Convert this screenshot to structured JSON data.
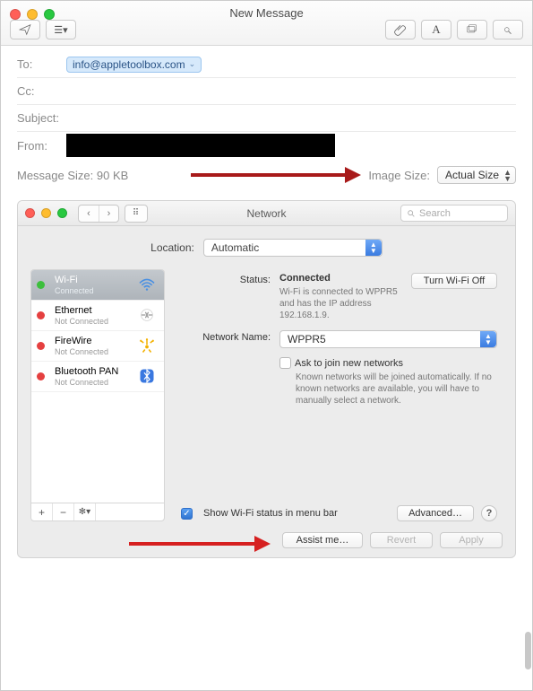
{
  "mail": {
    "title": "New Message",
    "to_label": "To:",
    "to_chip": "info@appletoolbox.com",
    "cc_label": "Cc:",
    "subject_label": "Subject:",
    "from_label": "From:",
    "message_size_label": "Message Size: 90 KB",
    "image_size_label": "Image Size:",
    "image_size_value": "Actual Size"
  },
  "network": {
    "title": "Network",
    "search_placeholder": "Search",
    "location_label": "Location:",
    "location_value": "Automatic",
    "sidebar": {
      "items": [
        {
          "name": "Wi-Fi",
          "sub": "Connected",
          "status": "green",
          "icon": "wifi",
          "selected": true
        },
        {
          "name": "Ethernet",
          "sub": "Not Connected",
          "status": "red",
          "icon": "ethernet",
          "selected": false
        },
        {
          "name": "FireWire",
          "sub": "Not Connected",
          "status": "red",
          "icon": "firewire",
          "selected": false
        },
        {
          "name": "Bluetooth PAN",
          "sub": "Not Connected",
          "status": "red",
          "icon": "bluetooth",
          "selected": false
        }
      ],
      "plus": "+",
      "minus": "−",
      "gear": "✻▾"
    },
    "detail": {
      "status_label": "Status:",
      "status_value": "Connected",
      "turn_off_btn": "Turn Wi-Fi Off",
      "status_note": "Wi-Fi is connected to WPPR5 and has the IP address 192.168.1.9.",
      "network_name_label": "Network Name:",
      "network_name_value": "WPPR5",
      "ask_join_label": "Ask to join new networks",
      "ask_join_note": "Known networks will be joined automatically. If no known networks are available, you will have to manually select a network.",
      "show_menu_label": "Show Wi-Fi status in menu bar",
      "advanced_btn": "Advanced…",
      "help": "?",
      "assist_btn": "Assist me…",
      "revert_btn": "Revert",
      "apply_btn": "Apply"
    }
  }
}
